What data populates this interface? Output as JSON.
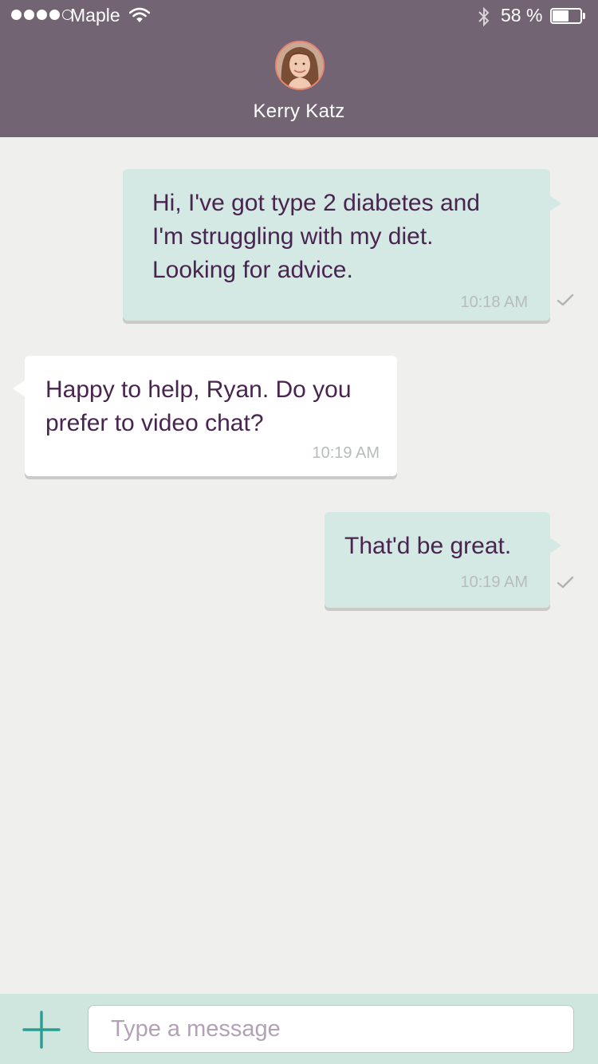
{
  "status_bar": {
    "signal_filled": 4,
    "signal_total": 5,
    "carrier": "Maple",
    "battery_percent": "58 %",
    "battery_level": 0.58
  },
  "header": {
    "contact_name": "Kerry Katz",
    "background_color": "#736474"
  },
  "messages": [
    {
      "direction": "outgoing",
      "text": "Hi, I've got type 2 diabetes and\nI'm struggling with my diet.\nLooking for advice.",
      "time": "10:18 AM",
      "read": true
    },
    {
      "direction": "incoming",
      "text": "Happy to help, Ryan. Do you\nprefer to video chat?",
      "time": "10:19 AM"
    },
    {
      "direction": "outgoing",
      "text": "That'd be great.",
      "time": "10:19 AM",
      "read": true
    }
  ],
  "composer": {
    "placeholder": "Type a message",
    "value": "",
    "add_icon": "plus-icon"
  },
  "colors": {
    "outgoing_bubble": "#d4e9e3",
    "incoming_bubble": "#ffffff",
    "text": "#4a2450",
    "accent": "#2a9d92"
  }
}
